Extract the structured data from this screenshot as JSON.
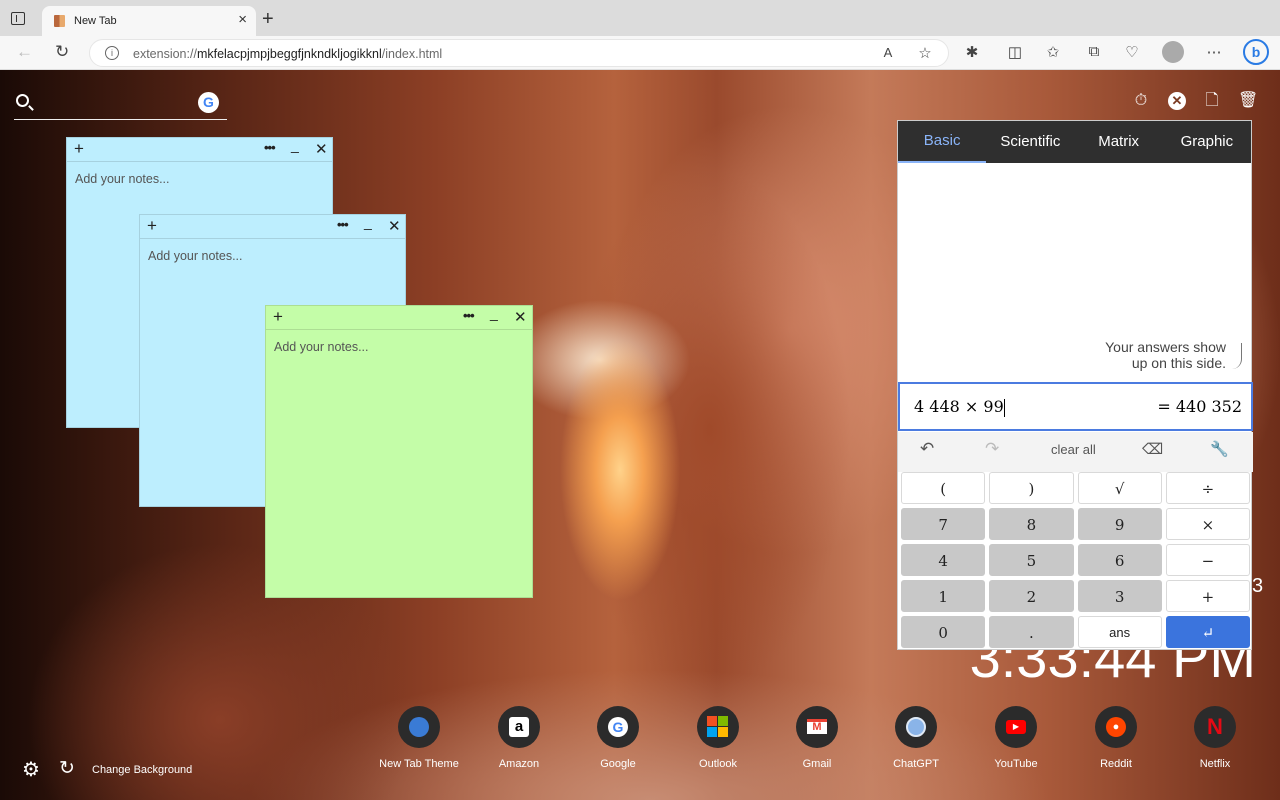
{
  "browser": {
    "tab_title": "New Tab",
    "url_prefix": "extension://",
    "url_host": "mkfelacpjmpjbeggfjnkndkljogikknl",
    "url_path": "/index.html"
  },
  "notes": [
    {
      "placeholder": "Add your notes...",
      "color": "#bdeefe"
    },
    {
      "placeholder": "Add your notes...",
      "color": "#bdeefe"
    },
    {
      "placeholder": "Add your notes...",
      "color": "#c4fda8"
    }
  ],
  "calculator": {
    "tabs": [
      "Basic",
      "Scientific",
      "Matrix",
      "Graphic"
    ],
    "active_tab": "Basic",
    "hint_line1": "Your answers show",
    "hint_line2": "up on this side.",
    "expression": "4 448 × 99",
    "result": "= 440 352",
    "clear_label": "clear all",
    "keys": [
      "(",
      ")",
      "√",
      "÷",
      "7",
      "8",
      "9",
      "×",
      "4",
      "5",
      "6",
      "−",
      "1",
      "2",
      "3",
      "+",
      "0",
      ".",
      "ans",
      "↵"
    ]
  },
  "clock": {
    "small": "3",
    "time": "3:33:44 PM"
  },
  "bottom": {
    "change_bg": "Change Background"
  },
  "shortcuts": [
    {
      "label": "New Tab Theme",
      "icon": "new-tab-theme-icon"
    },
    {
      "label": "Amazon",
      "icon": "amazon-icon"
    },
    {
      "label": "Google",
      "icon": "google-icon"
    },
    {
      "label": "Outlook",
      "icon": "outlook-icon"
    },
    {
      "label": "Gmail",
      "icon": "gmail-icon"
    },
    {
      "label": "ChatGPT",
      "icon": "chatgpt-icon"
    },
    {
      "label": "YouTube",
      "icon": "youtube-icon"
    },
    {
      "label": "Reddit",
      "icon": "reddit-icon"
    },
    {
      "label": "Netflix",
      "icon": "netflix-icon"
    }
  ]
}
